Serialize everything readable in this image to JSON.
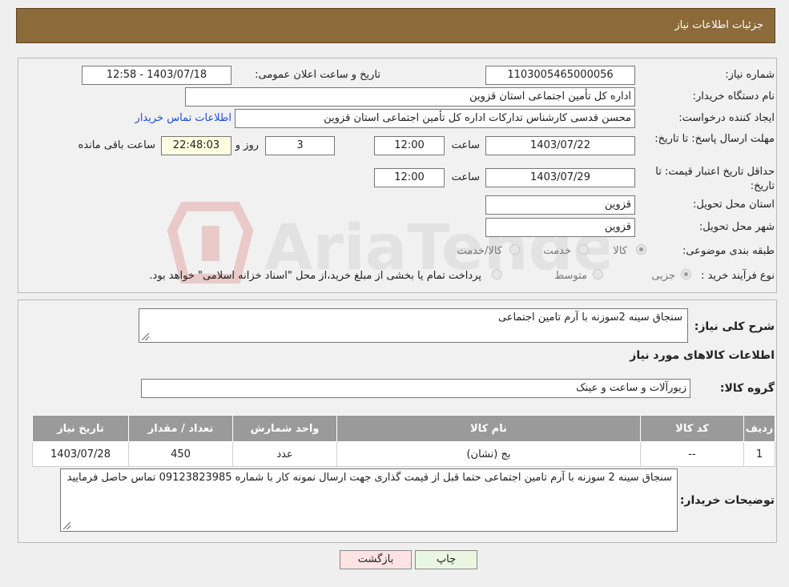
{
  "header": {
    "title": "جزئیات اطلاعات نیاز"
  },
  "form": {
    "need_number_label": "شماره نیاز:",
    "need_number": "1103005465000056",
    "announce_label": "تاریخ و ساعت اعلان عمومی:",
    "announce_value": "1403/07/18 - 12:58",
    "buyer_org_label": "نام دستگاه خریدار:",
    "buyer_org": "اداره کل تأمین اجتماعی استان قزوین",
    "creator_label": "ایجاد کننده درخواست:",
    "creator": "محسن قدسی کارشناس تدارکات اداره کل تأمین اجتماعی استان قزوین",
    "contact_link": "اطلاعات تماس خریدار",
    "reply_deadline_label": "مهلت ارسال پاسخ: تا تاریخ:",
    "reply_date": "1403/07/22",
    "time_label": "ساعت",
    "reply_time": "12:00",
    "days_value": "3",
    "days_label": "روز و",
    "remaining_time": "22:48:03",
    "remaining_label": "ساعت باقی مانده",
    "validity_label": "حداقل تاریخ اعتبار قیمت: تا تاریخ:",
    "validity_date": "1403/07/29",
    "validity_time": "12:00",
    "province_label": "استان محل تحویل:",
    "province": "قزوین",
    "city_label": "شهر محل تحویل:",
    "city": "قزوین",
    "category_label": "طبقه بندی موضوعی:",
    "category_options": [
      "کالا",
      "خدمت",
      "کالا/خدمت"
    ],
    "process_label": "نوع فرآیند خرید :",
    "process_options": [
      "جزیی",
      "متوسط"
    ],
    "process_note": "پرداخت تمام یا بخشی از مبلغ خرید،از محل \"اسناد خزانه اسلامی\" خواهد بود."
  },
  "details": {
    "summary_label": "شرح کلی نیاز:",
    "summary": "سنجاق سینه 2سوزنه با آرم تامین اجتماعی",
    "goods_info_title": "اطلاعات کالاهای مورد نیاز",
    "group_label": "گروه کالا:",
    "group": "زیورآلات و ساعت و عینک",
    "table": {
      "headers": [
        "ردیف",
        "کد کالا",
        "نام کالا",
        "واحد شمارش",
        "تعداد / مقدار",
        "تاریخ نیاز"
      ],
      "rows": [
        [
          "1",
          "--",
          "بج (نشان)",
          "عدد",
          "450",
          "1403/07/28"
        ]
      ]
    },
    "buyer_notes_label": "توضیحات خریدار:",
    "buyer_notes": "سنجاق سینه 2 سوزنه با آرم تامین اجتماعی حتما قبل از قیمت گذاری جهت ارسال نمونه کار با شماره 09123823985 تماس حاصل فرمایید"
  },
  "buttons": {
    "print": "چاپ",
    "back": "بازگشت"
  },
  "watermark": "AriaTender.neT",
  "colors": {
    "header_bg": "#8c6a39",
    "back_button_bg": "#fde3e3",
    "print_button_bg": "#e9f7e2"
  }
}
